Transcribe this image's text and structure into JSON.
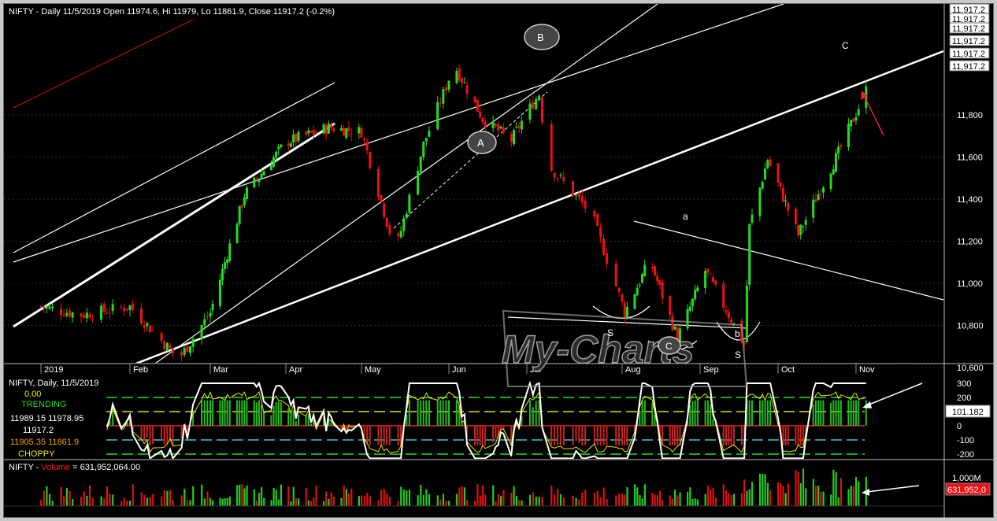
{
  "price_header": "NIFTY - Daily 11/5/2019 Open 11974.6, Hi 11979, Lo 11861.9, Close 11917.2 (-0.2%)",
  "osc_header": "NIFTY, Daily, 11/5/2019",
  "osc_labels": {
    "zero": "0.00",
    "trending": "TRENDING",
    "row1": "11989.15  11978.95",
    "row2": "11917.2",
    "row3": "11905.35  11861.9",
    "row4": "CHOPPY"
  },
  "osc_value_box": "101.182",
  "volume_header_prefix": "NIFTY - ",
  "volume_header_name": "Volume",
  "volume_header_value": " = 631,952,064.00",
  "volume_tick": "1,000M",
  "volume_value_box": "631,952,0",
  "watermark": "My-Charts",
  "price_box_labels": [
    "11,917.2",
    "11,917.2",
    "11,917.2",
    "11,917.2",
    "11,917.2",
    "11,917.2"
  ],
  "annotations": {
    "A": "A",
    "B": "B",
    "C_circle": "C",
    "C_top": "C",
    "a": "a",
    "b": "b",
    "S_left": "S",
    "S_right": "S"
  },
  "colors": {
    "up": "#22dd22",
    "down": "#ee1111",
    "trend": "#ffffff",
    "redline": "#cc1111",
    "grid": "#2a2a2a",
    "axis_text": "#ffffff"
  },
  "chart_data": [
    {
      "type": "candlestick",
      "title": "NIFTY - Daily 11/5/2019 Open 11974.6, Hi 11979, Lo 11861.9, Close 11917.2 (-0.2%)",
      "x_ticks": [
        "2019",
        "Feb",
        "Mar",
        "Apr",
        "May",
        "Jun",
        "Jul",
        "Aug",
        "Sep",
        "Oct",
        "Nov"
      ],
      "y_ticks": [
        10600,
        10800,
        11000,
        11200,
        11400,
        11600,
        11800
      ],
      "ylim": [
        10490,
        12050
      ],
      "last_close": 11917.2,
      "monthly_path": [
        {
          "x": "Jan 01",
          "y": 10890
        },
        {
          "x": "Jan 15",
          "y": 10850
        },
        {
          "x": "Feb 01",
          "y": 10890
        },
        {
          "x": "Feb 18",
          "y": 10640
        },
        {
          "x": "Mar 01",
          "y": 10860
        },
        {
          "x": "Mar 15",
          "y": 11420
        },
        {
          "x": "Apr 01",
          "y": 11670
        },
        {
          "x": "Apr 18",
          "y": 11740
        },
        {
          "x": "May 01",
          "y": 11720
        },
        {
          "x": "May 13",
          "y": 11150
        },
        {
          "x": "May 23",
          "y": 11660
        },
        {
          "x": "Jun 03",
          "y": 12040
        },
        {
          "x": "Jun 14",
          "y": 11780
        },
        {
          "x": "Jun 25",
          "y": 11680
        },
        {
          "x": "Jul 05",
          "y": 11900
        },
        {
          "x": "Jul 08",
          "y": 11560
        },
        {
          "x": "Jul 22",
          "y": 11330
        },
        {
          "x": "Aug 02",
          "y": 10860
        },
        {
          "x": "Aug 12",
          "y": 11110
        },
        {
          "x": "Aug 23",
          "y": 10740
        },
        {
          "x": "Sep 03",
          "y": 11060
        },
        {
          "x": "Sep 18",
          "y": 10710
        },
        {
          "x": "Sep 20",
          "y": 11270
        },
        {
          "x": "Sep 27",
          "y": 11590
        },
        {
          "x": "Oct 09",
          "y": 11230
        },
        {
          "x": "Oct 25",
          "y": 11620
        },
        {
          "x": "Nov 05",
          "y": 11917
        }
      ]
    },
    {
      "type": "line",
      "title": "NIFTY, Daily, 11/5/2019",
      "y_ticks": [
        300,
        200,
        100,
        0,
        -100,
        -200
      ],
      "ylim": [
        -240,
        330
      ],
      "last_value": 101.182
    },
    {
      "type": "bar",
      "title": "NIFTY - Volume = 631,952,064.00",
      "y_ticks": [
        "1,000M"
      ],
      "last_value": 631952064
    }
  ]
}
